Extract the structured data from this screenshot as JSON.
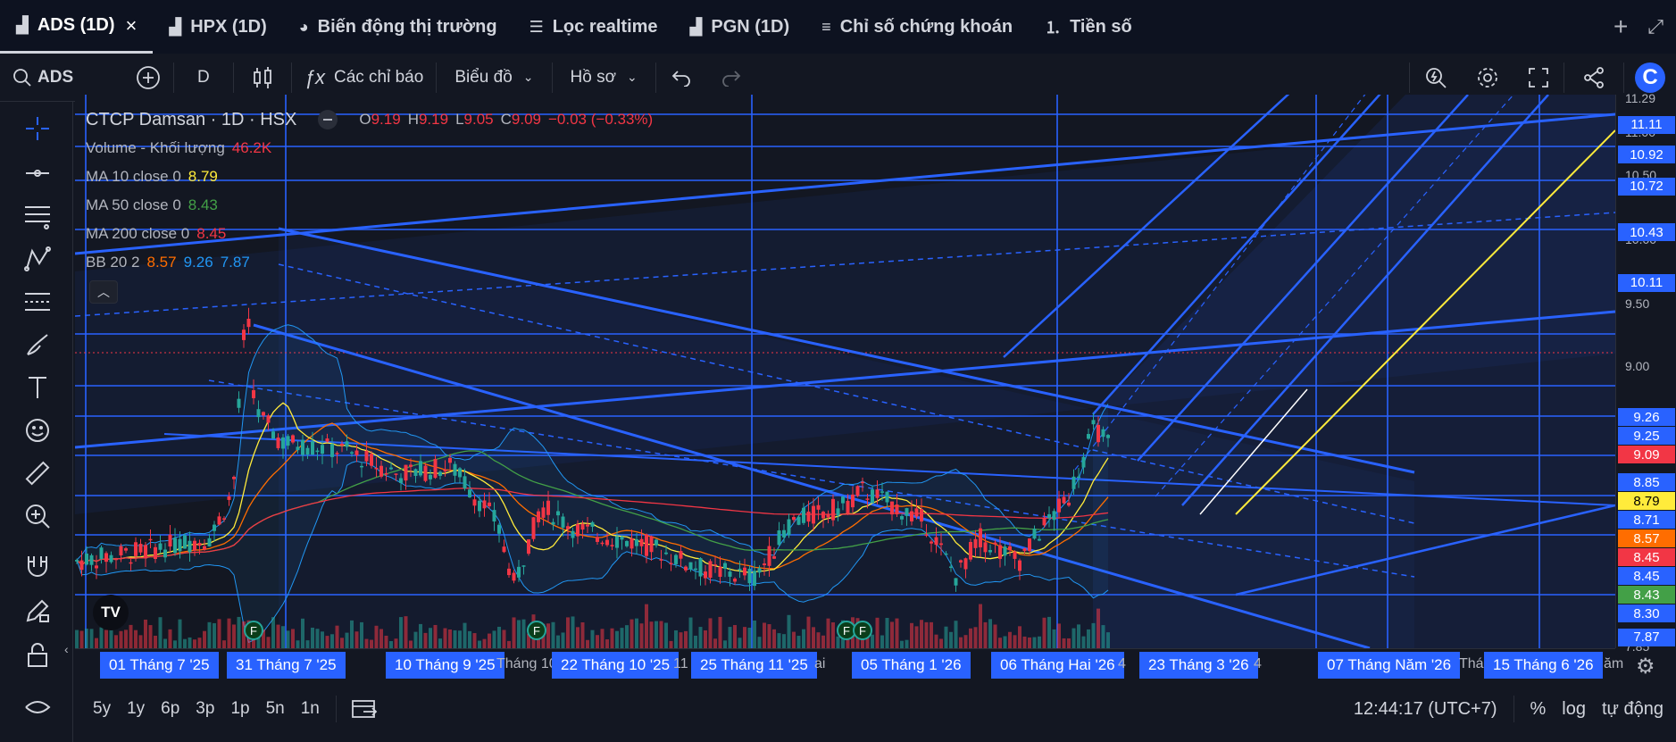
{
  "tabs": [
    {
      "label": "ADS (1D)",
      "icon": "chart-icon",
      "active": true
    },
    {
      "label": "HPX (1D)",
      "icon": "chart-icon"
    },
    {
      "label": "Biến động thị trường",
      "icon": "pie-chart-icon"
    },
    {
      "label": "Lọc realtime",
      "icon": "filter-icon"
    },
    {
      "label": "PGN (1D)",
      "icon": "chart-icon"
    },
    {
      "label": "Chỉ số chứng khoán",
      "icon": "list-icon"
    },
    {
      "label": "Tiền số",
      "icon": "numbered-list-icon"
    }
  ],
  "toolbar": {
    "symbol": "ADS",
    "interval": "D",
    "indicators_label": "Các chỉ báo",
    "chart_label": "Biểu đồ",
    "profile_label": "Hồ sơ"
  },
  "legend": {
    "title": "CTCP Damsan · 1D · HSX",
    "ohlc": {
      "o_label": "O",
      "o": "9.19",
      "h_label": "H",
      "h": "9.19",
      "l_label": "L",
      "l": "9.05",
      "c_label": "C",
      "c": "9.09",
      "change": "−0.03 (−0.33%)"
    },
    "volume_label": "Volume - Khối lượng",
    "volume": "46.2K",
    "ma10_label": "MA 10 close 0",
    "ma10": "8.79",
    "ma50_label": "MA 50 close 0",
    "ma50": "8.43",
    "ma200_label": "MA 200 close 0",
    "ma200": "8.45",
    "bb_label": "BB 20 2",
    "bb_basis": "8.57",
    "bb_upper": "9.26",
    "bb_lower": "7.87"
  },
  "price_axis": {
    "ticks": [
      "11.29",
      "11.00",
      "10.50",
      "10.00",
      "9.50",
      "9.00",
      "7.85"
    ],
    "labels": [
      {
        "value": "11.11",
        "color": "#2962ff"
      },
      {
        "value": "10.92",
        "color": "#2962ff"
      },
      {
        "value": "10.72",
        "color": "#2962ff"
      },
      {
        "value": "10.43",
        "color": "#2962ff"
      },
      {
        "value": "10.11",
        "color": "#2962ff"
      },
      {
        "value": "9.26",
        "color": "#2962ff"
      },
      {
        "value": "9.25",
        "color": "#2962ff"
      },
      {
        "value": "9.09",
        "color": "#f23645"
      },
      {
        "value": "8.85",
        "color": "#2962ff"
      },
      {
        "value": "8.79",
        "color": "#ffeb3b"
      },
      {
        "value": "8.71",
        "color": "#2962ff"
      },
      {
        "value": "8.57",
        "color": "#ff6d00"
      },
      {
        "value": "8.45",
        "color": "#f23645"
      },
      {
        "value": "8.45",
        "color": "#2962ff"
      },
      {
        "value": "8.43",
        "color": "#43a047"
      },
      {
        "value": "8.30",
        "color": "#2962ff"
      },
      {
        "value": "7.87",
        "color": "#2962ff"
      }
    ]
  },
  "time_axis": {
    "labels": [
      "01 Tháng 7 '25",
      "31 Tháng 7 '25",
      "10 Tháng 9 '25",
      "22 Tháng 10 '25",
      "25 Tháng 11 '25",
      "05 Tháng 1 '26",
      "06 Tháng Hai '26",
      "23 Tháng 3 '26",
      "07 Tháng Năm '26",
      "15 Tháng 6 '26"
    ],
    "plain": [
      "Tháng 10",
      "11",
      "ai",
      "4",
      "4",
      "Thá",
      "ăm"
    ]
  },
  "bottom": {
    "ranges": [
      "5y",
      "1y",
      "6p",
      "3p",
      "1p",
      "5n",
      "1n"
    ],
    "clock": "12:44:17 (UTC+7)",
    "percent": "%",
    "log": "log",
    "auto": "tự động"
  },
  "colors": {
    "bg": "#131722",
    "drawing": "#2962ff",
    "up": "#26a69a",
    "down": "#f23645",
    "ma10": "#ffeb3b",
    "ma50": "#43a047",
    "ma200": "#f23645",
    "bb": "#2196f3"
  },
  "events_label": "F",
  "tv_logo": "TV"
}
